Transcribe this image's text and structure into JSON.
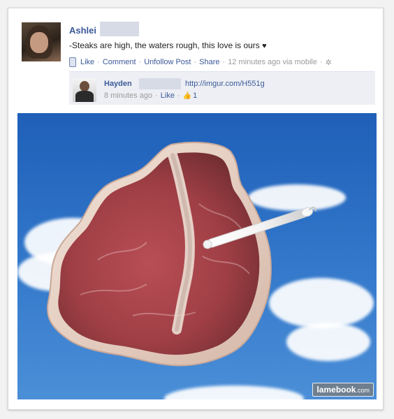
{
  "post": {
    "author": "Ashlei",
    "text": "-Steaks are high, the waters rough, this love is ours",
    "actions": {
      "like": "Like",
      "comment": "Comment",
      "unfollow": "Unfollow Post",
      "share": "Share",
      "timestamp": "12 minutes ago via mobile"
    }
  },
  "comment": {
    "author": "Hayden",
    "link": "http://imgur.com/H551g",
    "time": "8 minutes ago",
    "like": "Like",
    "like_count": "1"
  },
  "watermark": {
    "brand": "lamebook",
    "suffix": ".com"
  },
  "icons": {
    "mobile": "mobile-icon",
    "gear": "gear-icon",
    "thumb": "thumb-icon",
    "heart": "heart-icon"
  }
}
